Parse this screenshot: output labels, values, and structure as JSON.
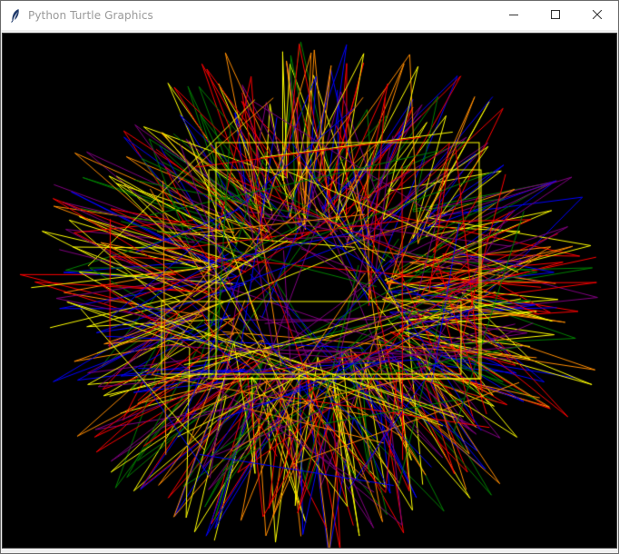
{
  "window": {
    "title": "Python Turtle Graphics",
    "icons": {
      "app": "feather-icon",
      "minimize": "minimize-icon",
      "maximize": "maximize-icon",
      "close": "close-icon"
    }
  },
  "canvas": {
    "background": "#000000",
    "pen_colors": [
      "#ffff00",
      "#ff0000",
      "#0000ff",
      "#008000",
      "#800080",
      "#ff8c00"
    ]
  }
}
